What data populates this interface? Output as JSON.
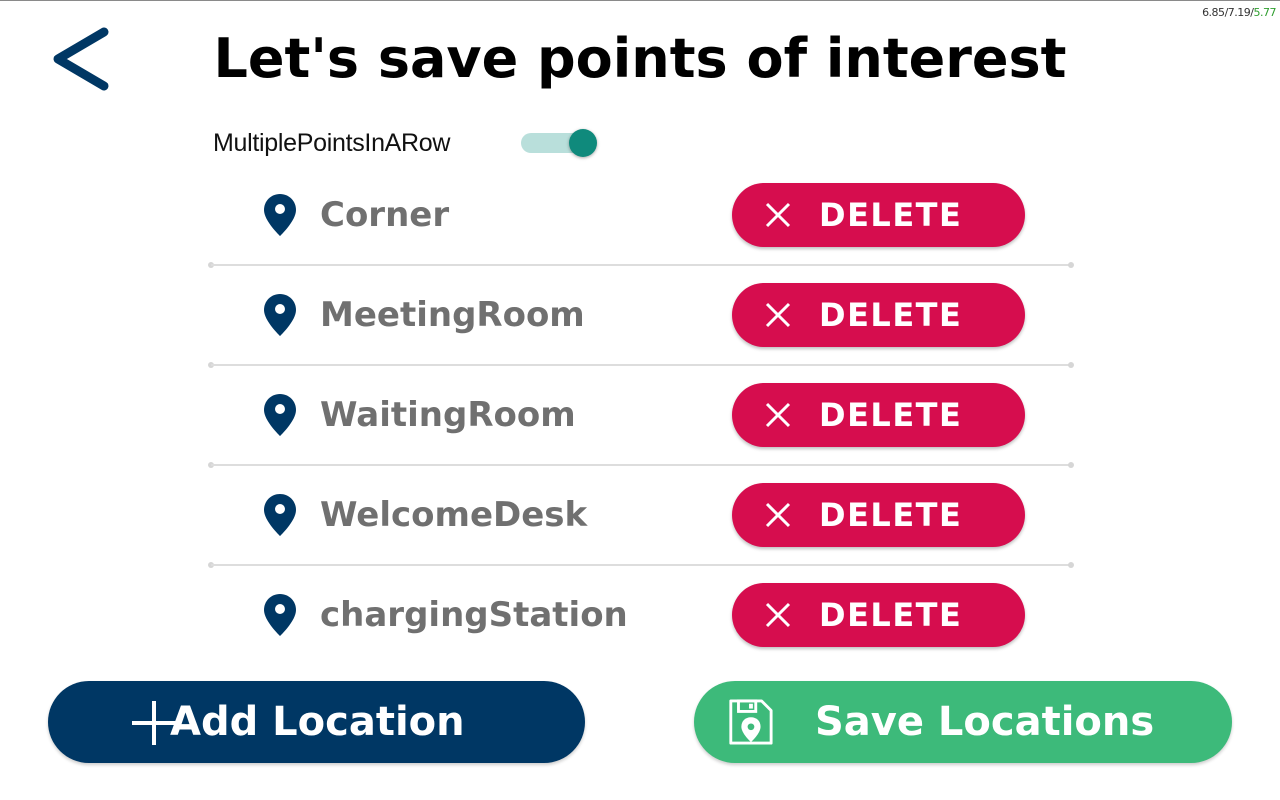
{
  "status_overlay": {
    "values": [
      "6.85",
      "7.19",
      "5.77"
    ],
    "separator": " / ",
    "colors": [
      "#333333",
      "#333333",
      "#2e9e2e"
    ]
  },
  "header": {
    "back_icon": "chevron-left-icon",
    "title": "Let's save points of interest"
  },
  "toggle": {
    "label": "MultiplePointsInARow",
    "on": true
  },
  "locations": {
    "icon": "map-pin-icon",
    "delete_icon": "close-icon",
    "items": [
      {
        "name": "Corner",
        "delete_label": "DELETE"
      },
      {
        "name": "MeetingRoom",
        "delete_label": "DELETE"
      },
      {
        "name": "WaitingRoom",
        "delete_label": "DELETE"
      },
      {
        "name": "WelcomeDesk",
        "delete_label": "DELETE"
      },
      {
        "name": "chargingStation",
        "delete_label": "DELETE"
      }
    ]
  },
  "actions": {
    "add": {
      "label": "Add Location",
      "icon": "plus-icon"
    },
    "save": {
      "label": "Save Locations",
      "icon": "save-location-icon"
    }
  },
  "colors": {
    "primary_navy": "#003764",
    "delete_red": "#d60d4e",
    "save_green": "#3dba7a",
    "toggle_on": "#0f8a7c",
    "toggle_track": "#b9dfdb",
    "item_text": "#707070"
  }
}
